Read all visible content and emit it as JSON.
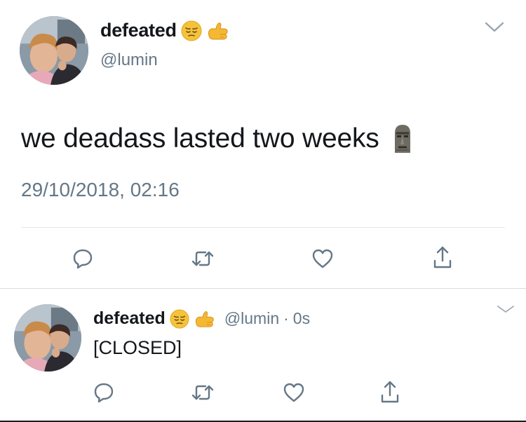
{
  "main_tweet": {
    "display_name": "defeated",
    "name_emojis": [
      "pensive-face-emoji",
      "call-me-hand-emoji"
    ],
    "handle": "@lumin",
    "text": "we deadass lasted two weeks",
    "text_emoji": "moai-emoji",
    "timestamp": "29/10/2018, 02:16",
    "actions": [
      "reply-icon",
      "retweet-icon",
      "like-icon",
      "share-icon"
    ]
  },
  "reply_tweet": {
    "display_name": "defeated",
    "name_emojis": [
      "pensive-face-emoji",
      "call-me-hand-emoji"
    ],
    "handle": "@lumin",
    "separator": "·",
    "time": "0s",
    "text": "[CLOSED]",
    "actions": [
      "reply-icon",
      "retweet-icon",
      "like-icon",
      "share-icon"
    ]
  },
  "colors": {
    "text_primary": "#14171a",
    "text_secondary": "#657786",
    "divider": "#e1e8ed",
    "icon": "#657786",
    "emoji_yellow": "#f5b833"
  }
}
